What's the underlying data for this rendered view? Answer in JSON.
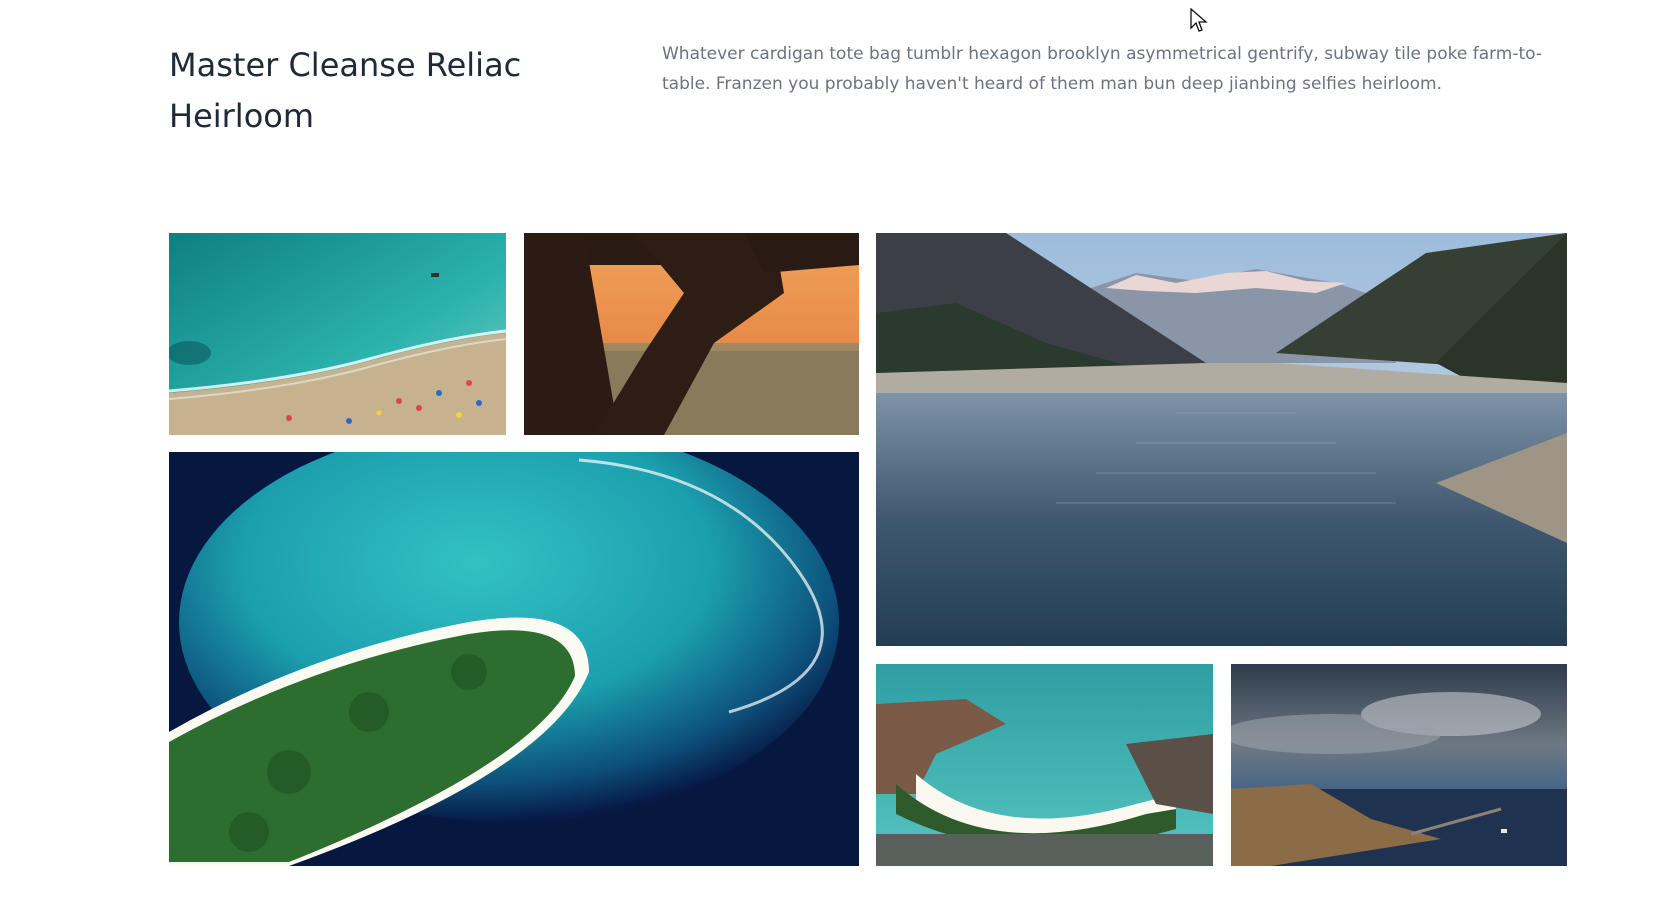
{
  "page": {
    "title": "Master Cleanse Reliac Heirloom",
    "description": "Whatever cardigan tote bag tumblr hexagon brooklyn asymmetrical gentrify, subway tile poke farm-to-table. Franzen you probably haven't heard of them man bun deep jianbing selfies heirloom."
  },
  "gallery": {
    "images": [
      {
        "name": "beach-aerial",
        "subject": "aerial view of beach with swimmers and umbrellas"
      },
      {
        "name": "sunset-silhouette",
        "subject": "dark silhouette framing orange sunset over field"
      },
      {
        "name": "mountain-lake",
        "subject": "lake between forested mountains with snowy peaks"
      },
      {
        "name": "island-aerial",
        "subject": "aerial view of forested island with turquoise reef"
      },
      {
        "name": "bay-aerial",
        "subject": "aerial view of turquoise bay with curved sandy shore"
      },
      {
        "name": "coast-storm",
        "subject": "coastal town under dramatic cloudy sky with pier"
      }
    ]
  },
  "colors": {
    "title": "#1f2937",
    "body_text": "#6b7280",
    "background": "#ffffff"
  }
}
